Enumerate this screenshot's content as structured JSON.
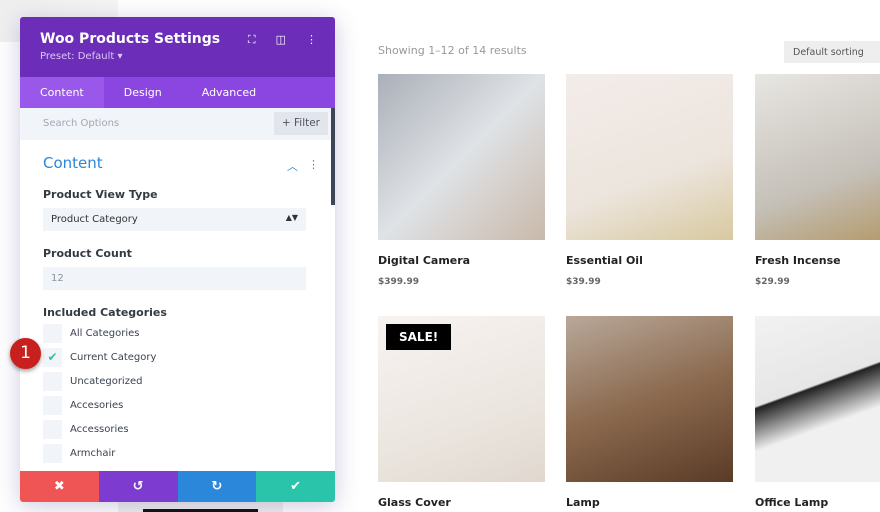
{
  "panel": {
    "title": "Woo Products Settings",
    "preset": "Preset: Default ▾",
    "tabs": [
      "Content",
      "Design",
      "Advanced"
    ],
    "search_placeholder": "Search Options",
    "filter": "+ Filter",
    "section": "Content",
    "product_view_type": {
      "label": "Product View Type",
      "value": "Product Category"
    },
    "product_count": {
      "label": "Product Count",
      "value": "12"
    },
    "included_categories": {
      "label": "Included Categories",
      "items": [
        {
          "label": "All Categories",
          "checked": false
        },
        {
          "label": "Current Category",
          "checked": true
        },
        {
          "label": "Uncategorized",
          "checked": false
        },
        {
          "label": "Accesories",
          "checked": false
        },
        {
          "label": "Accessories",
          "checked": false
        },
        {
          "label": "Armchair",
          "checked": false
        }
      ]
    },
    "colors": {
      "header": "#6c2eb9",
      "tabs": "#8b45e0",
      "cancel": "#ef5555",
      "undo": "#7e3bd0",
      "redo": "#2b87da",
      "save": "#29c4a9"
    }
  },
  "annotation": "1",
  "shop": {
    "result_count": "Showing 1–12 of 14 results",
    "sorting": "Default sorting",
    "sale_badge": "SALE!",
    "products": [
      {
        "name": "Digital Camera",
        "price": "$399.99"
      },
      {
        "name": "Essential Oil",
        "price": "$39.99"
      },
      {
        "name": "Fresh Incense",
        "price": "$29.99"
      },
      {
        "name": "Glass Cover",
        "price": ""
      },
      {
        "name": "Lamp",
        "price": ""
      },
      {
        "name": "Office Lamp",
        "price": ""
      }
    ]
  }
}
